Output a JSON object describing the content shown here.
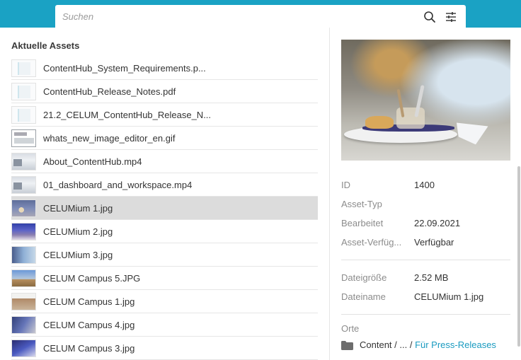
{
  "search": {
    "placeholder": "Suchen"
  },
  "icons": {
    "search": "search-icon",
    "filter": "filter-sliders-icon",
    "folder": "folder-icon"
  },
  "colors": {
    "topbar": "#1aa2c4",
    "link": "#1a9bc0",
    "selected_row": "#dcdcdc"
  },
  "left": {
    "title": "Aktuelle Assets",
    "assets": [
      {
        "name": "ContentHub_System_Requirements.p...",
        "thumb": "doc"
      },
      {
        "name": "ContentHub_Release_Notes.pdf",
        "thumb": "doc"
      },
      {
        "name": "21.2_CELUM_ContentHub_Release_N...",
        "thumb": "doc"
      },
      {
        "name": "whats_new_image_editor_en.gif",
        "thumb": "gif"
      },
      {
        "name": "About_ContentHub.mp4",
        "thumb": "vid"
      },
      {
        "name": "01_dashboard_and_workspace.mp4",
        "thumb": "vid"
      },
      {
        "name": "CELUMium 1.jpg",
        "thumb": "img1",
        "selected": true
      },
      {
        "name": "CELUMium 2.jpg",
        "thumb": "img2"
      },
      {
        "name": "CELUMium 3.jpg",
        "thumb": "img3"
      },
      {
        "name": "CELUM Campus 5.JPG",
        "thumb": "img4"
      },
      {
        "name": "CELUM Campus 1.jpg",
        "thumb": "img5"
      },
      {
        "name": "CELUM Campus 4.jpg",
        "thumb": "img6"
      },
      {
        "name": "CELUM Campus 3.jpg",
        "thumb": "img7"
      }
    ]
  },
  "details": {
    "id_label": "ID",
    "id_value": "1400",
    "type_label": "Asset-Typ",
    "type_value": "",
    "edited_label": "Bearbeitet",
    "edited_value": "22.09.2021",
    "avail_label": "Asset-Verfüg...",
    "avail_value": "Verfügbar",
    "size_label": "Dateigröße",
    "size_value": "2.52 MB",
    "filename_label": "Dateiname",
    "filename_value": "CELUMium 1.jpg",
    "locations_label": "Orte",
    "path_prefix": "Content / ... /",
    "path_link": "Für Press-Releases"
  }
}
